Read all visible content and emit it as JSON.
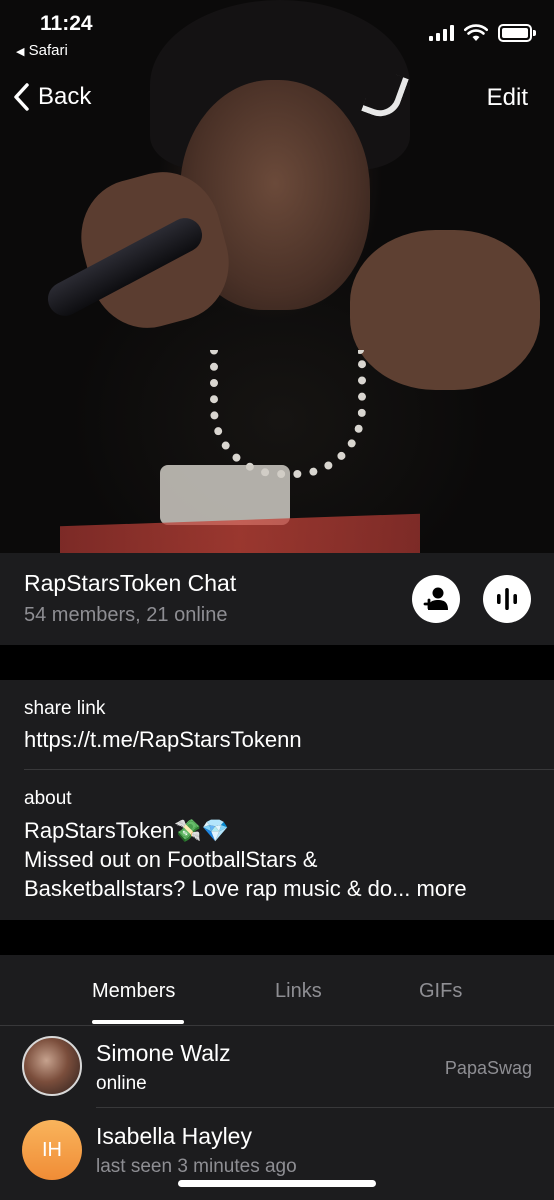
{
  "status_bar": {
    "time": "11:24",
    "back_app": "Safari"
  },
  "nav": {
    "back_label": "Back",
    "edit_label": "Edit"
  },
  "header": {
    "title": "RapStarsToken Chat",
    "subtitle": "54 members, 21 online",
    "add_member_icon": "add-person-icon",
    "voice_chat_icon": "voice-wave-icon"
  },
  "info": {
    "share_link_label": "share link",
    "share_link_value": "https://t.me/RapStarsTokenn",
    "about_label": "about",
    "about_line1": "RapStarsToken💸💎",
    "about_line2": "Missed out on FootballStars &",
    "about_line3": "Basketballstars? Love rap music & do...",
    "more_label": "more"
  },
  "tabs": [
    {
      "label": "Members",
      "active": true
    },
    {
      "label": "Links",
      "active": false
    },
    {
      "label": "GIFs",
      "active": false
    }
  ],
  "members": [
    {
      "name": "Simone Walz",
      "status": "online",
      "tag": "PapaSwag",
      "avatar": "photo"
    },
    {
      "name": "Isabella Hayley",
      "status": "last seen 3 minutes ago",
      "tag": "",
      "initials": "IH"
    }
  ],
  "colors": {
    "background": "#000000",
    "card": "#1c1c1e",
    "secondary_text": "#8e8e93",
    "avatar_orange": "#f5a04a"
  }
}
